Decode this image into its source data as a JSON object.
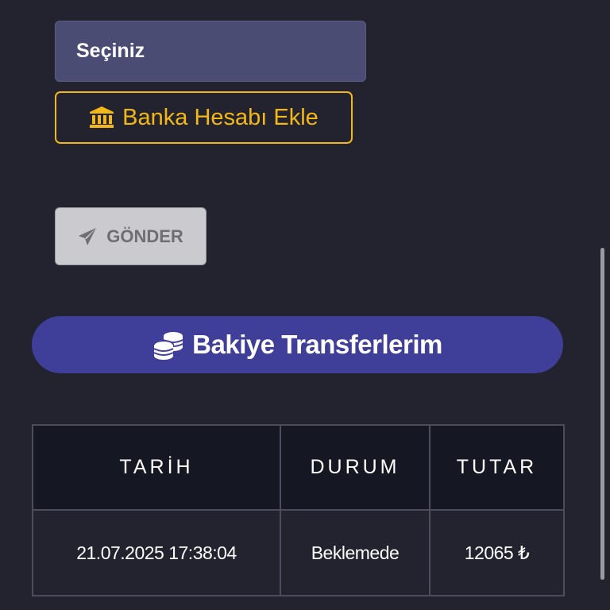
{
  "form": {
    "select_value": "Seçiniz",
    "add_bank_label": "Banka Hesabı Ekle",
    "send_label": "GÖNDER"
  },
  "section": {
    "title": "Bakiye Transferlerim"
  },
  "table": {
    "headers": {
      "date": "TARİH",
      "status": "DURUM",
      "amount": "TUTAR"
    },
    "rows": [
      {
        "date": "21.07.2025 17:38:04",
        "status": "Beklemede",
        "amount": "12065 ₺"
      }
    ]
  },
  "colors": {
    "background": "#22232e",
    "accent_yellow": "#f4b816",
    "banner_purple": "#3f3e98",
    "select_bg": "#4a4c74"
  }
}
